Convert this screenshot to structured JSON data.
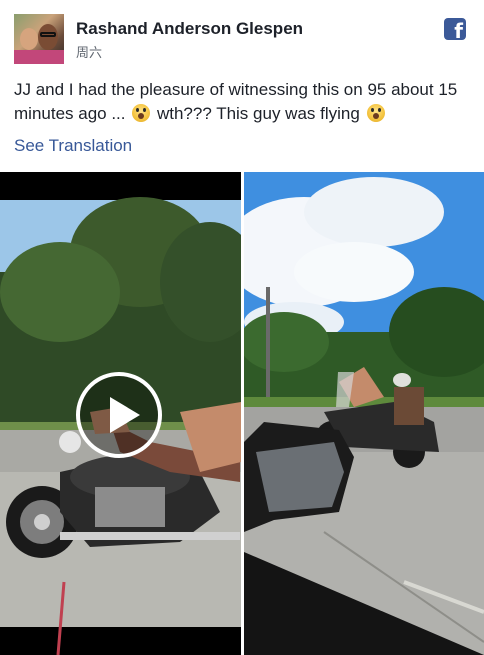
{
  "post": {
    "author": "Rashand Anderson Glespen",
    "date": "周六",
    "text_before_emoji1": "JJ and I had the pleasure of witnessing this on 95 about 15 minutes ago ... ",
    "text_between": " wth??? This guy was flying ",
    "emoji": "face-screaming-in-fear",
    "see_translation": "See Translation"
  },
  "icons": {
    "brand": "facebook-logo-icon",
    "play": "play-icon"
  },
  "colors": {
    "facebook_blue": "#3b5998",
    "link_blue": "#385898",
    "text": "#1d2129",
    "meta": "#606770"
  },
  "media": {
    "left": "video-thumbnail-motorcycle",
    "right": "photo-motorcycle-on-highway"
  }
}
